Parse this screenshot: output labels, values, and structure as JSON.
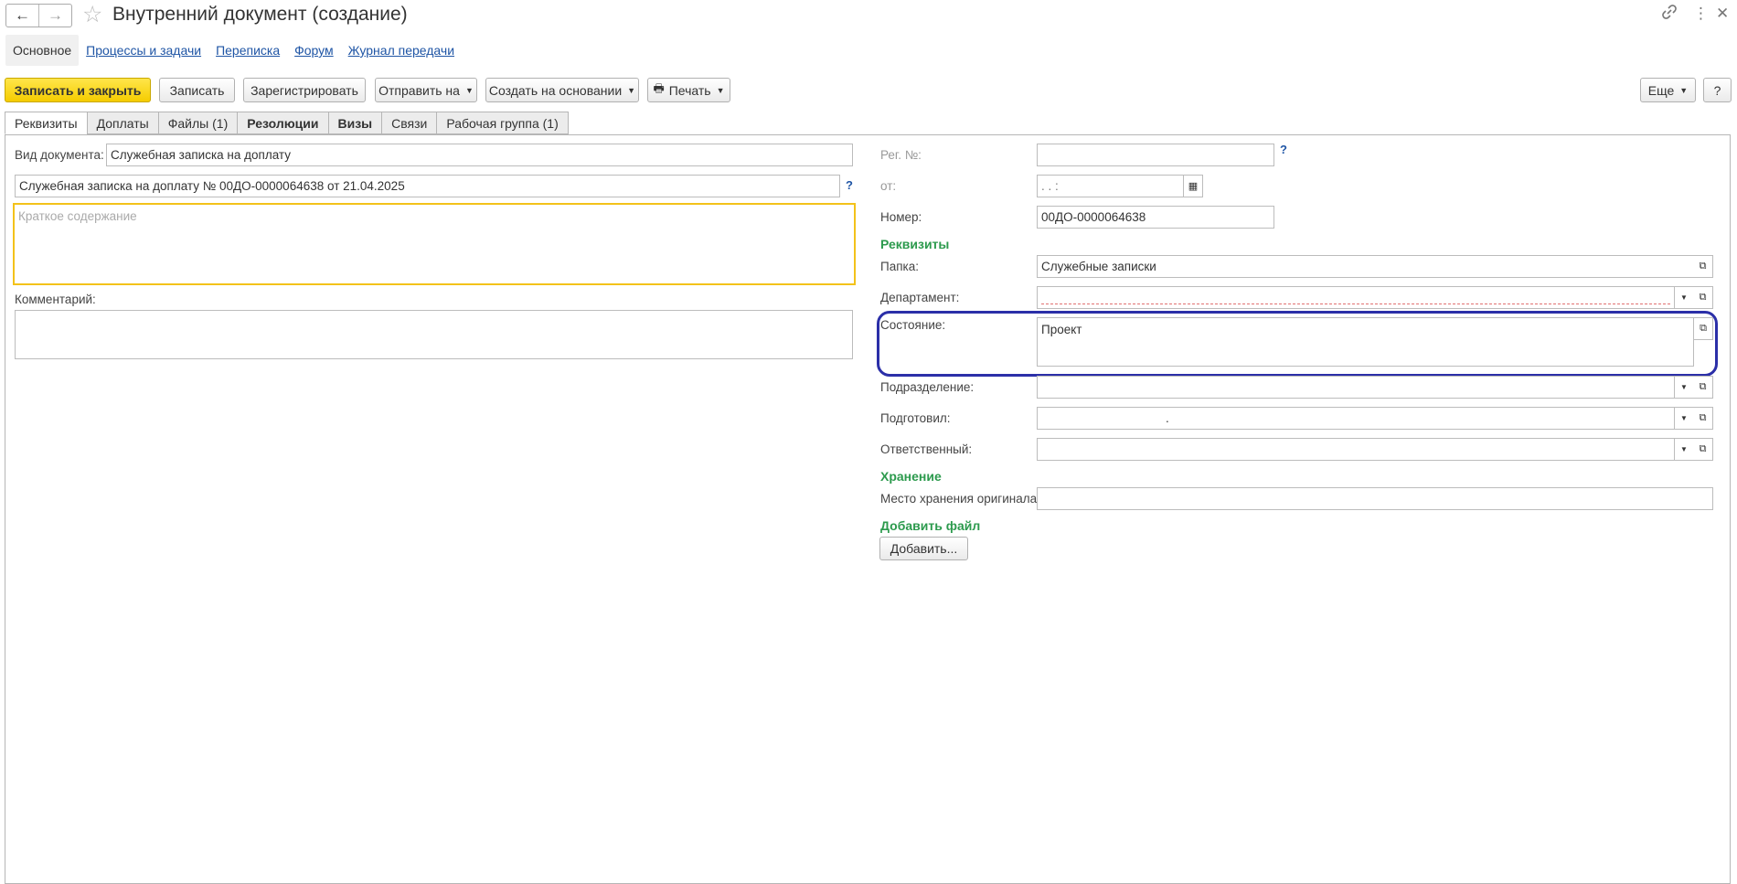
{
  "window": {
    "title": "Внутренний документ (создание)",
    "back_label": "🡐",
    "forward_label": "🡒"
  },
  "sections": [
    {
      "label": "Основное"
    },
    {
      "label": "Процессы и задачи"
    },
    {
      "label": "Переписка"
    },
    {
      "label": "Форум"
    },
    {
      "label": "Журнал передачи"
    }
  ],
  "toolbar": {
    "save_close": "Записать и закрыть",
    "save": "Записать",
    "register": "Зарегистрировать",
    "send_to": "Отправить на",
    "create_based": "Создать на основании",
    "print": "Печать",
    "more": "Еще",
    "help": "?"
  },
  "tabs": [
    {
      "label": "Реквизиты"
    },
    {
      "label": "Доплаты"
    },
    {
      "label": "Файлы (1)"
    },
    {
      "label": "Резолюции"
    },
    {
      "label": "Визы"
    },
    {
      "label": "Связи"
    },
    {
      "label": "Рабочая группа (1)"
    }
  ],
  "left": {
    "doc_type_label": "Вид документа:",
    "doc_type_value": "Служебная записка на доплату",
    "title_value": "Служебная записка на доплату № 00ДО-0000064638 от 21.04.2025",
    "title_help": "?",
    "summary_placeholder": "Краткое содержание",
    "comment_label": "Комментарий:",
    "comment_value": ""
  },
  "right": {
    "reg_label": "Рег. №:",
    "reg_value": "",
    "reg_help": "?",
    "date_label": "от:",
    "date_value": " .  .       :",
    "number_label": "Номер:",
    "number_value": "00ДО-0000064638",
    "requisites_header": "Реквизиты",
    "folder_label": "Папка:",
    "folder_value": "Служебные записки",
    "department_label": "Департамент:",
    "department_value": "",
    "state_label": "Состояние:",
    "state_value": "Проект",
    "subdivision_label": "Подразделение:",
    "subdivision_value": "",
    "prepared_label": "Подготовил:",
    "prepared_value": ".",
    "responsible_label": "Ответственный:",
    "responsible_value": "",
    "storage_header": "Хранение",
    "storage_place_label": "Место хранения оригинала:",
    "storage_place_value": "",
    "add_file_header": "Добавить файл",
    "add_button": "Добавить..."
  },
  "colors": {
    "accent_yellow": "#f5cc00",
    "link_blue": "#1f55a5",
    "section_green": "#2c9a4d",
    "highlight_ring": "#2b2fa8"
  }
}
